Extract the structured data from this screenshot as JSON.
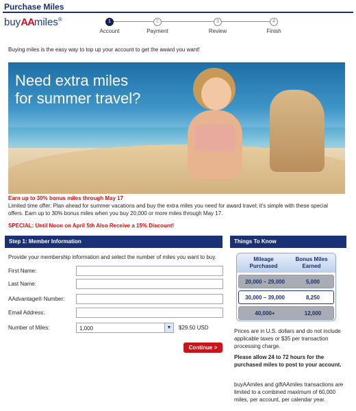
{
  "page": {
    "title": "Purchase Miles"
  },
  "brand": {
    "prefix": "buy",
    "mark": "AA",
    "suffix": "miles",
    "reg": "®"
  },
  "steps": [
    {
      "number": "1",
      "label": "Account",
      "active": true
    },
    {
      "number": "2",
      "label": "Payment",
      "active": false
    },
    {
      "number": "3",
      "label": "Review",
      "active": false
    },
    {
      "number": "4",
      "label": "Finish",
      "active": false
    }
  ],
  "intro": "Buying miles is the easy way to top up your account to get the award you want!",
  "hero": {
    "line1": "Need extra miles",
    "line2": "for summer travel?"
  },
  "promo": {
    "headline": "Earn up to 30% bonus miles through May 17",
    "text": "Limited time offer: Plan ahead for summer vacations and buy the extra miles you need for award travel; it's simple with these special offers. Earn up to 30% bonus miles when you buy 20,000 or more miles through May 17.",
    "special": "SPECIAL: Until Noon on April 5th Also Receive a 15% Discount!"
  },
  "step1": {
    "heading": "Step 1: Member Information",
    "intro": "Provide your membership information and select the number of miles you want to buy.",
    "fields": {
      "first_name": {
        "label": "First Name:",
        "value": ""
      },
      "last_name": {
        "label": "Last Name:",
        "value": ""
      },
      "aadvantage": {
        "label": "AAdvantage® Number:",
        "value": ""
      },
      "email": {
        "label": "Email Address:",
        "value": ""
      }
    },
    "miles": {
      "label": "Number of Miles:",
      "selected": "1,000",
      "price": "$29.50 USD"
    },
    "continue_label": "Continue >"
  },
  "things": {
    "heading": "Things To Know",
    "table": {
      "col1": "Mileage Purchased",
      "col2": "Bonus Miles Earned",
      "rows": [
        {
          "purchased": "20,000 – 29,000",
          "bonus": "5,000"
        },
        {
          "purchased": "30,000 – 39,000",
          "bonus": "8,250"
        },
        {
          "purchased": "40,000+",
          "bonus": "12,000"
        }
      ]
    },
    "note1": "Prices are in U.S. dollars and do not include applicable taxes or $35 per transaction processing charge.",
    "note2": "Please allow 24 to 72 hours for the purchased miles to post to your account.",
    "note3": "buyAAmiles and giftAAmiles transactions are limited to a combined maximum of 60,000 miles, per account, per calendar year."
  },
  "colors": {
    "navy": "#1a3175",
    "red": "#cc1111",
    "button": "#c8141b"
  }
}
